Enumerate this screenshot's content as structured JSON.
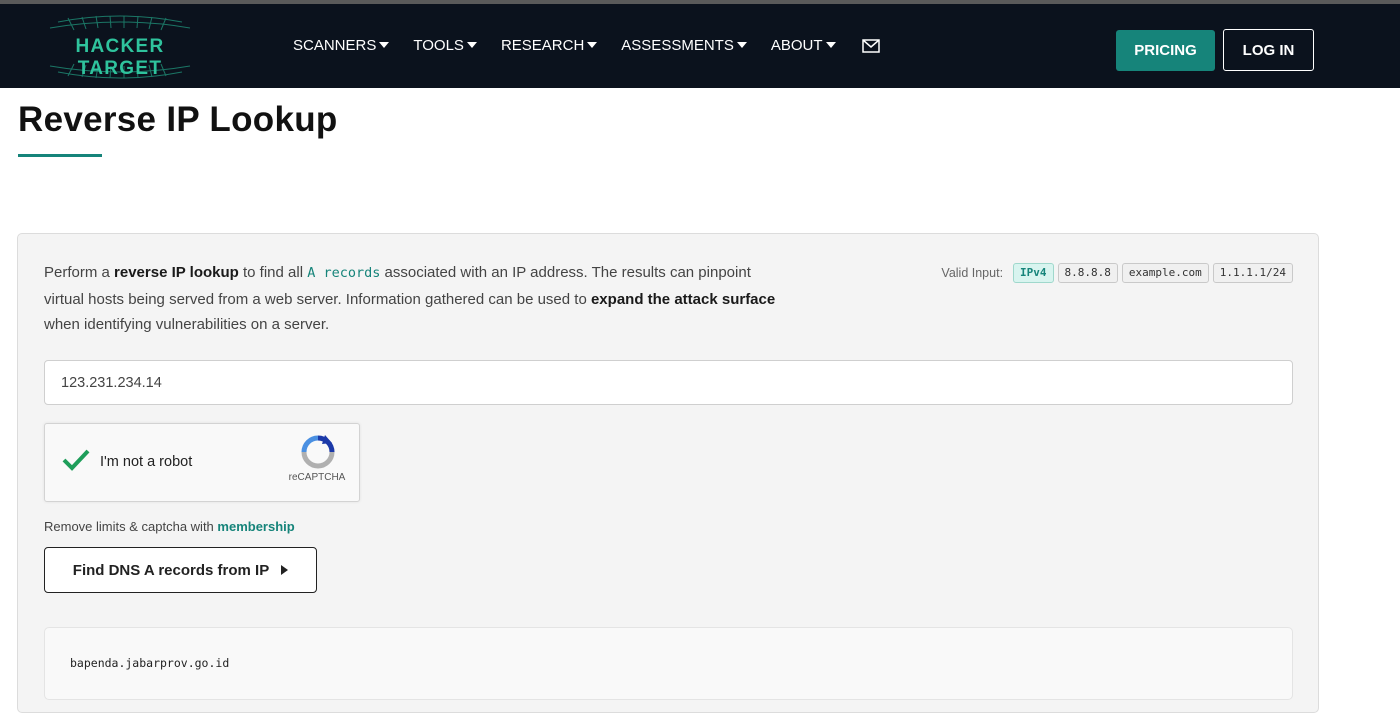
{
  "header": {
    "logo_text": "HACKER TARGET",
    "nav": [
      {
        "label": "SCANNERS"
      },
      {
        "label": "TOOLS"
      },
      {
        "label": "RESEARCH"
      },
      {
        "label": "ASSESSMENTS"
      },
      {
        "label": "ABOUT"
      }
    ],
    "mail_icon": "envelope-icon",
    "pricing_label": "PRICING",
    "login_label": "LOG IN"
  },
  "page": {
    "title": "Reverse IP Lookup"
  },
  "tool": {
    "intro": {
      "t1": "Perform a ",
      "b1": "reverse IP lookup",
      "t2": " to find all ",
      "code1": "A records",
      "t3": " associated with an IP address. The results can pinpoint virtual hosts being served from a web server. Information gathered can be used to ",
      "b2": "expand the attack surface",
      "t4": " when identifying vulnerabilities on a server."
    },
    "valid_input_label": "Valid Input:",
    "valid_inputs": [
      "IPv4",
      "8.8.8.8",
      "example.com",
      "1.1.1.1/24"
    ],
    "ip_value": "123.231.234.14",
    "captcha_label": "I'm not a robot",
    "captcha_brand": "reCAPTCHA",
    "membership_text": "Remove limits & captcha with ",
    "membership_link": "membership",
    "submit_label": "Find DNS A records from IP",
    "results": [
      "bapenda.jabarprov.go.id"
    ]
  },
  "colors": {
    "navbar_bg": "#0b121d",
    "accent": "#16847a",
    "logo": "#2fc39d"
  }
}
